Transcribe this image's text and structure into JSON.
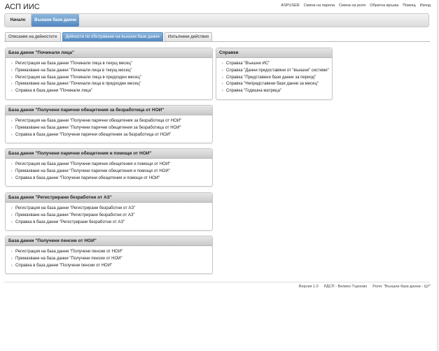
{
  "app": {
    "title": "АСП ИИС"
  },
  "topnav": [
    "ASPUSER",
    "Смяна на парола",
    "Смяна на роля",
    "Обратна връзка",
    "Помощ",
    "Изход"
  ],
  "menu": {
    "home": "Начало",
    "active": "Външни бази данни"
  },
  "tabs": [
    "Описание на дейностите",
    "Дейности по обслужване на външни бази данни",
    "Изпълнени действия"
  ],
  "panels": [
    {
      "title": "База данни \"Починали лица\"",
      "items": [
        "Регистрация на база данни \"Починали лица в текущ месец\"",
        "Премахване на база данни \"Починали лица в текущ месец\"",
        "Регистрация на база данни \"Починали лица в предходен месец\"",
        "Премахване на база данни \"Починали лица в предходен месец\"",
        "Справка в база данни \"Починали лица\""
      ]
    },
    {
      "title": "Справки",
      "items": [
        "Справка \"Външни ИС\"",
        "Справка \"Данни предоставяни от \"външни\" системи\"",
        "Справка \"Представени бази данни за период\"",
        "Справка \"Непредставени бази данни за месец\"",
        "Справка \"Годишна матрица\""
      ]
    },
    {
      "title": "База данни \"Получени парични обещетения за безработица от НОИ\"",
      "items": [
        "Регистрация на база данни \"Получени парични обещетения за безработица от НОИ\"",
        "Премахване на база данни \"Получени парични обещетения за безработица от НОИ\"",
        "Справка в база данни \"Получени парични обещетения за безработица от НОИ\""
      ]
    },
    {
      "title": "База данни \"Получени парични обещетения и помощи от НОИ\"",
      "items": [
        "Регистрация на база данни \"Получени парични обещетения и помощи от НОИ\"",
        "Премахване на база данни \"Получени парични обещетения и помощи от НОИ\"",
        "Справка в база данни \"Получени парични обещетения и помощи от НОИ\""
      ]
    },
    {
      "title": "База данни \"Регистрирани безработни от АЗ\"",
      "items": [
        "Регистрация на база данни \"Регистрирани безработни от АЗ\"",
        "Премахване на база данни \"Регистрирани безработни от АЗ\"",
        "Справка в база данни \"Регистрирани безработни от АЗ\""
      ]
    },
    {
      "title": "База данни \"Получени пенсии от НОИ\"",
      "items": [
        "Регистрация на база данни \"Получени пенсии от НОИ\"",
        "Премахване на база данни \"Получени пенсии от НОИ\"",
        "Справка в база данни \"Получени пенсии от НОИ\""
      ]
    }
  ],
  "footer": [
    "Версия 1.0",
    "РДСП - Велико Търново",
    "Роля: \"Външни бази данни - ЦУ\""
  ]
}
